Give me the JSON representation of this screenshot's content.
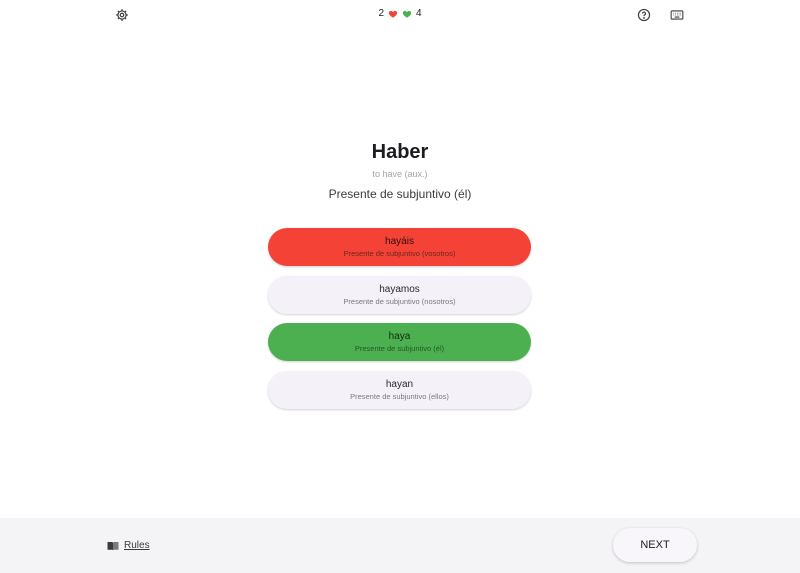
{
  "header": {
    "settings_icon": "gear-icon",
    "help_icon": "help-circle-icon",
    "keyboard_icon": "keyboard-icon",
    "score": {
      "wrong_count": "2",
      "correct_count": "4",
      "wrong_color": "#f44336",
      "correct_color": "#4caf50"
    }
  },
  "question": {
    "verb": "Haber",
    "translation": "to have (aux.)",
    "prompt": "Presente de subjuntivo (él)"
  },
  "options": [
    {
      "text": "hayáis",
      "subtitle": "Presente de subjuntivo (vosotros)",
      "state": "wrong"
    },
    {
      "text": "hayamos",
      "subtitle": "Presente de subjuntivo (nosotros)",
      "state": "neutral"
    },
    {
      "text": "haya",
      "subtitle": "Presente de subjuntivo (él)",
      "state": "correct"
    },
    {
      "text": "hayan",
      "subtitle": "Presente de subjuntivo (ellos)",
      "state": "neutral"
    }
  ],
  "footer": {
    "rules_label": "Rules",
    "rules_icon": "book-icon",
    "next_label": "NEXT"
  },
  "colors": {
    "wrong": "#f44336",
    "correct": "#4caf50",
    "neutral": "#f4f1f8",
    "footer_bg": "#f4f3f5"
  }
}
